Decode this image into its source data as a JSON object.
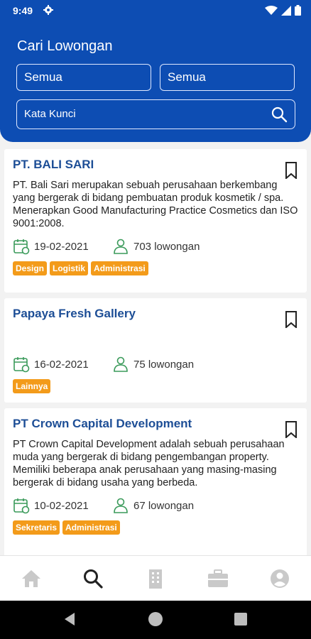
{
  "status": {
    "time": "9:49"
  },
  "header": {
    "title": "Cari Lowongan",
    "filter1": "Semua",
    "filter2": "Semua",
    "search_placeholder": "Kata Kunci"
  },
  "jobs": [
    {
      "company": "PT. BALI SARI",
      "description": "PT. Bali Sari merupakan sebuah perusahaan berkembang yang bergerak di bidang pembuatan produk kosmetik / spa. Menerapkan Good Manufacturing Practice Cosmetics dan ISO 9001:2008.",
      "date": "19-02-2021",
      "vacancies": "703 lowongan",
      "tags": [
        "Design",
        "Logistik",
        "Administrasi"
      ]
    },
    {
      "company": "Papaya Fresh Gallery",
      "description": "",
      "date": "16-02-2021",
      "vacancies": "75 lowongan",
      "tags": [
        "Lainnya"
      ]
    },
    {
      "company": "PT Crown Capital Development",
      "description": "PT Crown Capital Development adalah sebuah perusahaan muda yang bergerak di bidang pengembangan property.  Memiliki beberapa anak perusahaan yang masing-masing bergerak di bidang usaha yang berbeda.",
      "date": "10-02-2021",
      "vacancies": "67 lowongan",
      "tags": [
        "Sekretaris",
        "Administrasi"
      ]
    }
  ],
  "nav": [
    "home-icon",
    "search-icon",
    "building-icon",
    "briefcase-icon",
    "profile-icon"
  ],
  "colors": {
    "primary": "#0d4db3",
    "tag": "#f39b1a",
    "title": "#1d4e96",
    "icon_green": "#3a9a5a"
  }
}
